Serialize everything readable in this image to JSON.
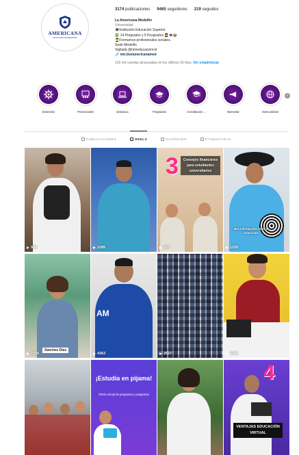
{
  "profile": {
    "logo_text": "AMERICANA",
    "logo_sub": "INSTITUCIÓN UNIVERSITARIA",
    "stats": [
      {
        "value": "3174",
        "label": "publicaciones"
      },
      {
        "value": "9465",
        "label": "seguidores"
      },
      {
        "value": "219",
        "label": "seguidos"
      }
    ],
    "name": "La Americana Medellín",
    "category": "Universidad",
    "bio_lines": [
      "🎓Institución Educación Superior",
      "📗 14 Pregrados y 5 Posgrados 👩‍🎓💻📦",
      "👨‍🎓Formamos profesionales sociales.",
      "Sede Medellín",
      "Vigilada @mineducacioncol"
    ],
    "link": "🔗 mtr.bio/americanamed",
    "reach_text": "103 mil cuentas alcanzadas en los últimos 30 días.",
    "reach_link": "Ver estadísticas"
  },
  "highlights": [
    {
      "label": "Extensión",
      "icon": "gear-icon"
    },
    {
      "label": "Presenciales",
      "icon": "classroom-icon"
    },
    {
      "label": "Distancia",
      "icon": "laptop-icon"
    },
    {
      "label": "Posgrados",
      "icon": "graduation-cap-icon"
    },
    {
      "label": "Acreditación ...",
      "icon": "graduation-cap-icon"
    },
    {
      "label": "Bienestar",
      "icon": "megaphone-icon"
    },
    {
      "label": "Intercambios",
      "icon": "globe-icon"
    }
  ],
  "tabs": [
    {
      "label": "PUBLICACIONES",
      "icon": "grid-icon"
    },
    {
      "label": "REELS",
      "icon": "reels-icon"
    },
    {
      "label": "GUARDADO",
      "icon": "bookmark-icon"
    },
    {
      "label": "ETIQUETADAS",
      "icon": "tag-icon"
    }
  ],
  "reels": [
    {
      "count": "996"
    },
    {
      "count": "1085"
    },
    {
      "count": "837",
      "big": "3",
      "text": "Consejos financieros para estudiantes universitarios"
    },
    {
      "count": "1109",
      "text": "Más información sobre la Americana"
    },
    {
      "count": "2265",
      "text": "Sanchez Días"
    },
    {
      "count": "4363"
    },
    {
      "count": "2527"
    },
    {
      "count": "5291"
    },
    {
      "count": ""
    },
    {
      "count": "",
      "heading": "¡Estudia en pijama!",
      "text": "Oferta virtual de pregrados y posgrados"
    },
    {
      "count": ""
    },
    {
      "count": "",
      "big": "4",
      "text": "VENTAJAS EDUCACIÓN VIRTUAL"
    }
  ],
  "colors": {
    "highlight_purple": "#5a167f",
    "link_blue": "#00376b",
    "accent_blue": "#0095f6",
    "brand_navy": "#1e3a8a"
  }
}
